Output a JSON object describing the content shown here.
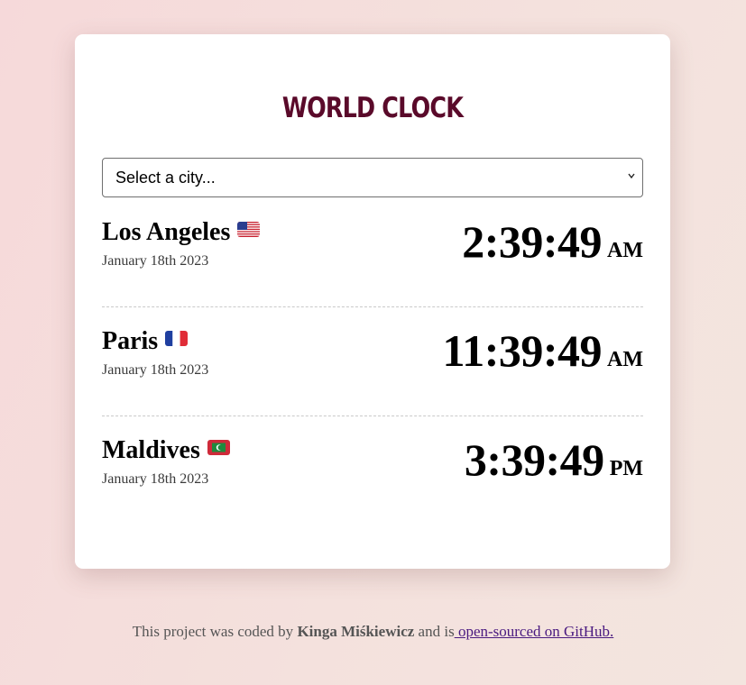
{
  "app": {
    "title": "WORLD CLOCK"
  },
  "city_select": {
    "selected_label": "Select a city..."
  },
  "cities": [
    {
      "name": "Los Angeles",
      "flag": "us-flag-icon",
      "date": "January 18th 2023",
      "time": "2:39:49",
      "ampm": "AM"
    },
    {
      "name": "Paris",
      "flag": "france-flag-icon",
      "date": "January 18th 2023",
      "time": "11:39:49",
      "ampm": "AM"
    },
    {
      "name": "Maldives",
      "flag": "maldives-flag-icon",
      "date": "January 18th 2023",
      "time": "3:39:49",
      "ampm": "PM"
    }
  ],
  "footer": {
    "prefix": "This project was coded by ",
    "author": "Kinga Miśkiewicz",
    "middle": " and is",
    "link_text": " open-sourced on GitHub."
  },
  "colors": {
    "title": "#5a0a2a",
    "link": "#4a1a80",
    "background": "#f6d9da"
  }
}
